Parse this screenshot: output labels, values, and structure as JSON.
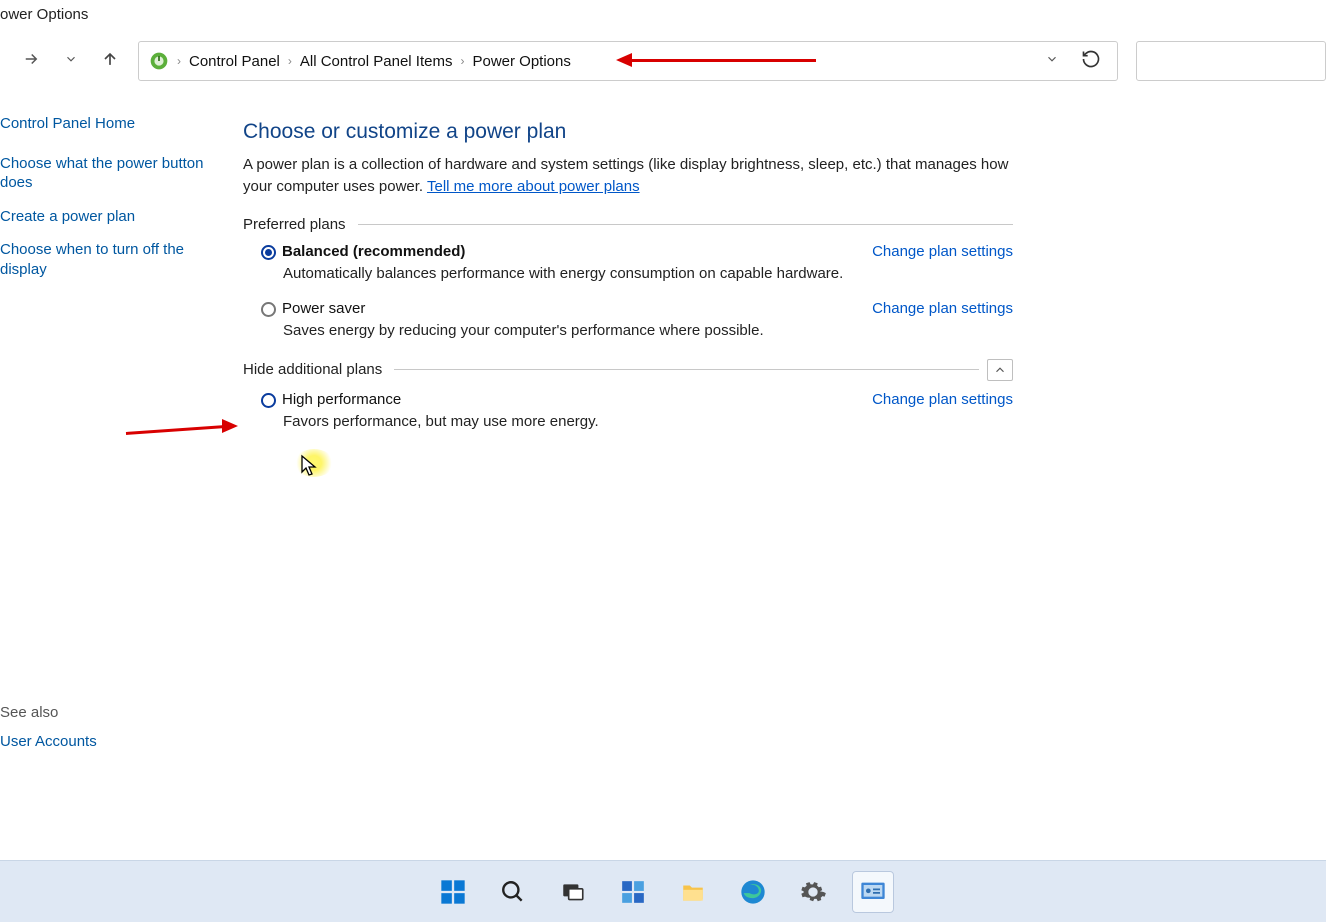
{
  "window_title": "ower Options",
  "breadcrumb": {
    "items": [
      "Control Panel",
      "All Control Panel Items",
      "Power Options"
    ]
  },
  "sidebar": {
    "home": "Control Panel Home",
    "links": [
      "Choose what the power button does",
      "Create a power plan",
      "Choose when to turn off the display"
    ]
  },
  "main": {
    "heading": "Choose or customize a power plan",
    "description": "A power plan is a collection of hardware and system settings (like display brightness, sleep, etc.) that manages how your computer uses power. ",
    "more_link": "Tell me more about power plans",
    "preferred_label": "Preferred plans",
    "additional_label": "Hide additional plans",
    "change_link_label": "Change plan settings",
    "plans": {
      "balanced": {
        "title": "Balanced (recommended)",
        "desc": "Automatically balances performance with energy consumption on capable hardware."
      },
      "powersaver": {
        "title": "Power saver",
        "desc": "Saves energy by reducing your computer's performance where possible."
      },
      "highperf": {
        "title": "High performance",
        "desc": "Favors performance, but may use more energy."
      }
    }
  },
  "see_also": {
    "label": "See also",
    "link": "User Accounts"
  },
  "taskbar_icons": [
    "start",
    "search",
    "task-view",
    "widgets",
    "file-explorer",
    "edge",
    "settings",
    "control-panel"
  ]
}
